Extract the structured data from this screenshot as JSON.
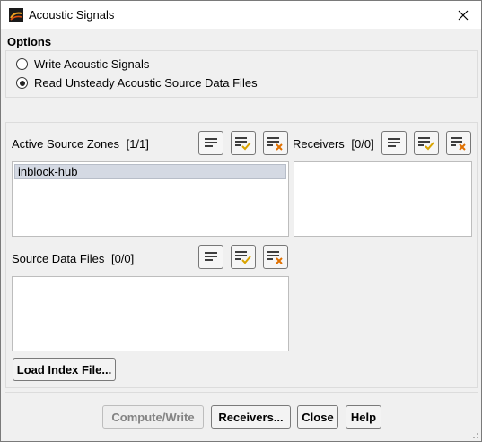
{
  "window": {
    "title": "Acoustic Signals",
    "title_icon": "fluent-app-icon",
    "close_icon": "close-icon"
  },
  "options": {
    "label": "Options",
    "radios": [
      {
        "label": "Write Acoustic Signals",
        "checked": false
      },
      {
        "label": "Read Unsteady Acoustic Source Data Files",
        "checked": true
      }
    ]
  },
  "active_source_zones": {
    "label": "Active Source Zones",
    "count": "[1/1]",
    "items": [
      "inblock-hub"
    ]
  },
  "receivers": {
    "label": "Receivers",
    "count": "[0/0]",
    "items": []
  },
  "source_data_files": {
    "label": "Source Data Files",
    "count": "[0/0]",
    "items": []
  },
  "list_tools": {
    "icons": [
      "list-all-icon",
      "select-all-icon",
      "deselect-all-icon"
    ]
  },
  "buttons": {
    "load_index": "Load Index File...",
    "compute_write": "Compute/Write",
    "receivers": "Receivers...",
    "close": "Close",
    "help": "Help"
  },
  "colors": {
    "selected_item": "#d4d9e3",
    "check": "#d9a400",
    "cross": "#e07000"
  }
}
